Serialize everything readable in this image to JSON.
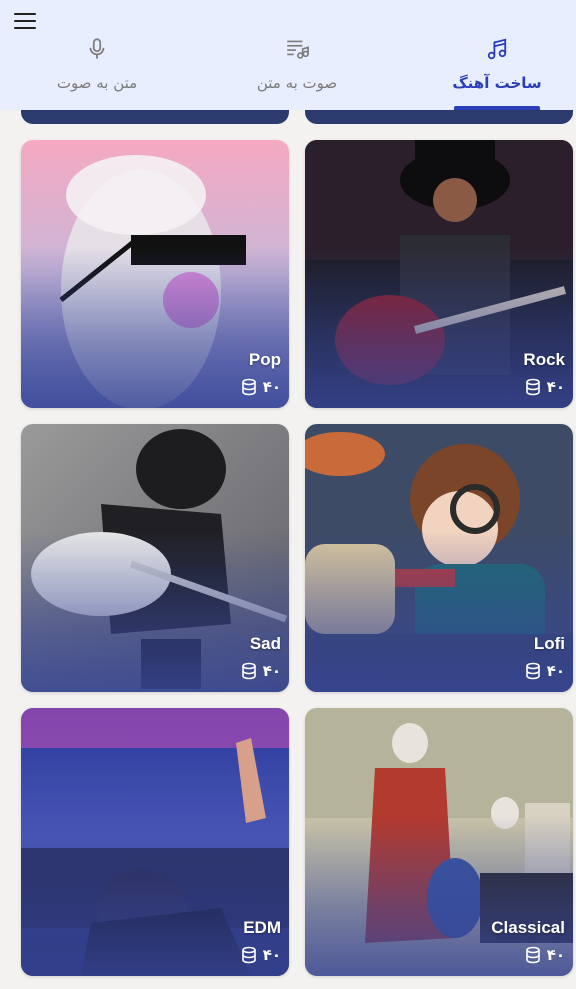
{
  "header": {
    "tabs": [
      {
        "label": "ساخت آهنگ",
        "icon": "music-notes-icon",
        "active": true
      },
      {
        "label": "صوت به متن",
        "icon": "playlist-music-icon",
        "active": false
      },
      {
        "label": "متن به صوت",
        "icon": "microphone-icon",
        "active": false
      }
    ]
  },
  "genres": [
    {
      "title": "Pop",
      "cost": "۴۰"
    },
    {
      "title": "Rock",
      "cost": "۴۰"
    },
    {
      "title": "Sad",
      "cost": "۴۰"
    },
    {
      "title": "Lofi",
      "cost": "۴۰"
    },
    {
      "title": "EDM",
      "cost": "۴۰"
    },
    {
      "title": "Classical",
      "cost": "۴۰"
    }
  ],
  "colors": {
    "accent": "#2a3fb7",
    "header_bg": "#e9eefe",
    "page_bg": "#f3f2f0"
  }
}
